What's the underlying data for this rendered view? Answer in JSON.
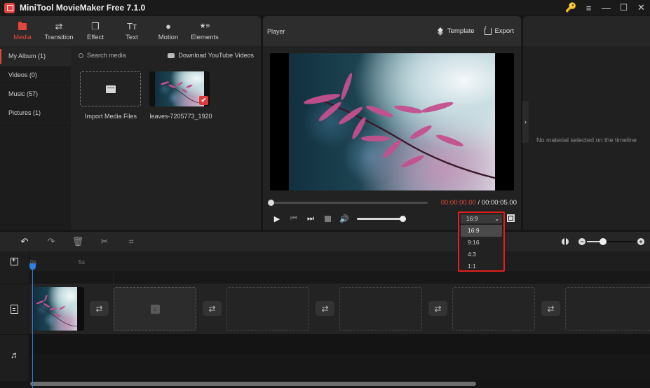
{
  "app": {
    "title": "MiniTool MovieMaker Free 7.1.0",
    "window_controls": [
      {
        "name": "key-icon",
        "glyph": "🔑"
      },
      {
        "name": "menu-icon",
        "glyph": "≡"
      },
      {
        "name": "minimize-icon",
        "glyph": "—"
      },
      {
        "name": "maximize-icon",
        "glyph": "☐"
      },
      {
        "name": "close-icon",
        "glyph": "✕"
      }
    ]
  },
  "toolbar": {
    "tabs": [
      {
        "id": "media",
        "label": "Media",
        "icon": "folder-icon",
        "glyph": "",
        "active": true
      },
      {
        "id": "transition",
        "label": "Transition",
        "icon": "transition-icon",
        "glyph": "⇄"
      },
      {
        "id": "effect",
        "label": "Effect",
        "icon": "effect-icon",
        "glyph": "❐"
      },
      {
        "id": "text",
        "label": "Text",
        "icon": "text-icon",
        "glyph": "Tт"
      },
      {
        "id": "motion",
        "label": "Motion",
        "icon": "motion-icon",
        "glyph": "●"
      },
      {
        "id": "elements",
        "label": "Elements",
        "icon": "elements-icon",
        "glyph": "★≡"
      }
    ],
    "accent_color": "#e2463f"
  },
  "media": {
    "categories": [
      {
        "label": "My Album (1)",
        "active": true
      },
      {
        "label": "Videos (0)"
      },
      {
        "label": "Music (57)"
      },
      {
        "label": "Pictures (1)"
      }
    ],
    "search_placeholder": "Search media",
    "download_label": "Download YouTube Videos",
    "import_label": "Import Media Files",
    "items": [
      {
        "name": "leaves-7205773_1920",
        "selected": true
      }
    ]
  },
  "player": {
    "title": "Player",
    "template_label": "Template",
    "export_label": "Export",
    "current_time": "00:00:00.00",
    "separator": " / ",
    "total_time": "00:00:05.00",
    "progress": 0,
    "volume": 1.0,
    "aspect_ratio": {
      "selected": "16:9",
      "options": [
        "16:9",
        "9:16",
        "4:3",
        "1:1"
      ],
      "highlight_color": "#e21f1f"
    }
  },
  "properties": {
    "empty_text": "No material selected on the timeline"
  },
  "timeline": {
    "tools": [
      {
        "name": "undo-icon",
        "glyph": "↶",
        "enabled": true
      },
      {
        "name": "redo-icon",
        "glyph": "↷",
        "enabled": false
      },
      {
        "name": "delete-icon",
        "glyph": "🗑",
        "enabled": false
      },
      {
        "name": "split-icon",
        "glyph": "✂",
        "enabled": false
      },
      {
        "name": "crop-icon",
        "glyph": "⌗",
        "enabled": false
      }
    ],
    "zoom_level": 0.33,
    "ruler_ticks": [
      "0s",
      "5s"
    ],
    "playhead_color": "#2f7fe0",
    "clips": [
      {
        "name": "leaves-7205773_1920"
      }
    ],
    "empty_slots": 5,
    "transition_glyph": "⇄"
  }
}
